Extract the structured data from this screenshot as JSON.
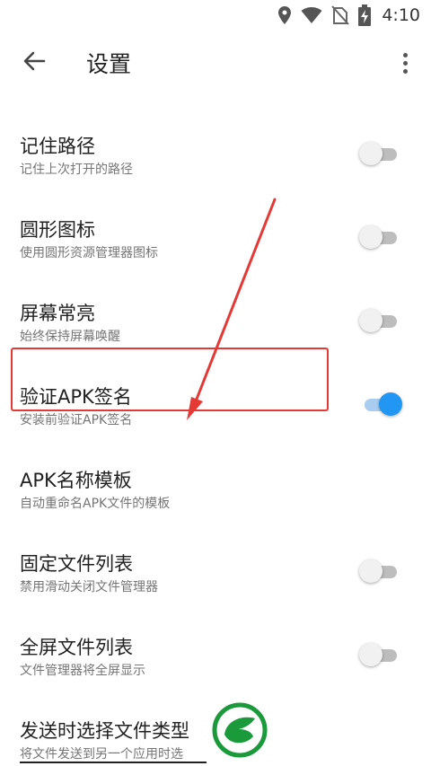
{
  "status_bar": {
    "time": "4:10",
    "icons": [
      "location-icon",
      "wifi-icon",
      "no-sim-icon",
      "battery-charging-icon"
    ]
  },
  "app_bar": {
    "title": "设置",
    "back_icon": "arrow-back-icon",
    "more_icon": "more-vert-icon"
  },
  "settings": [
    {
      "title": "记住路径",
      "summary": "记住上次打开的路径",
      "switch": "off"
    },
    {
      "title": "圆形图标",
      "summary": "使用圆形资源管理器图标",
      "switch": "off"
    },
    {
      "title": "屏幕常亮",
      "summary": "始终保持屏幕唤醒",
      "switch": "off"
    },
    {
      "title": "验证APK签名",
      "summary": "安装前验证APK签名",
      "switch": "on"
    },
    {
      "title": "APK名称模板",
      "summary": "自动重命名APK文件的模板",
      "switch": null
    },
    {
      "title": "固定文件列表",
      "summary": "禁用滑动关闭文件管理器",
      "switch": "off"
    },
    {
      "title": "全屏文件列表",
      "summary": "文件管理器将全屏显示",
      "switch": "off"
    },
    {
      "title": "发送时选择文件类型",
      "summary": "将文件发送到另一个应用时选",
      "switch": null
    }
  ],
  "colors": {
    "accent": "#2196f3",
    "annotation": "#e53935",
    "watermark_green": "#1a9a3a"
  }
}
